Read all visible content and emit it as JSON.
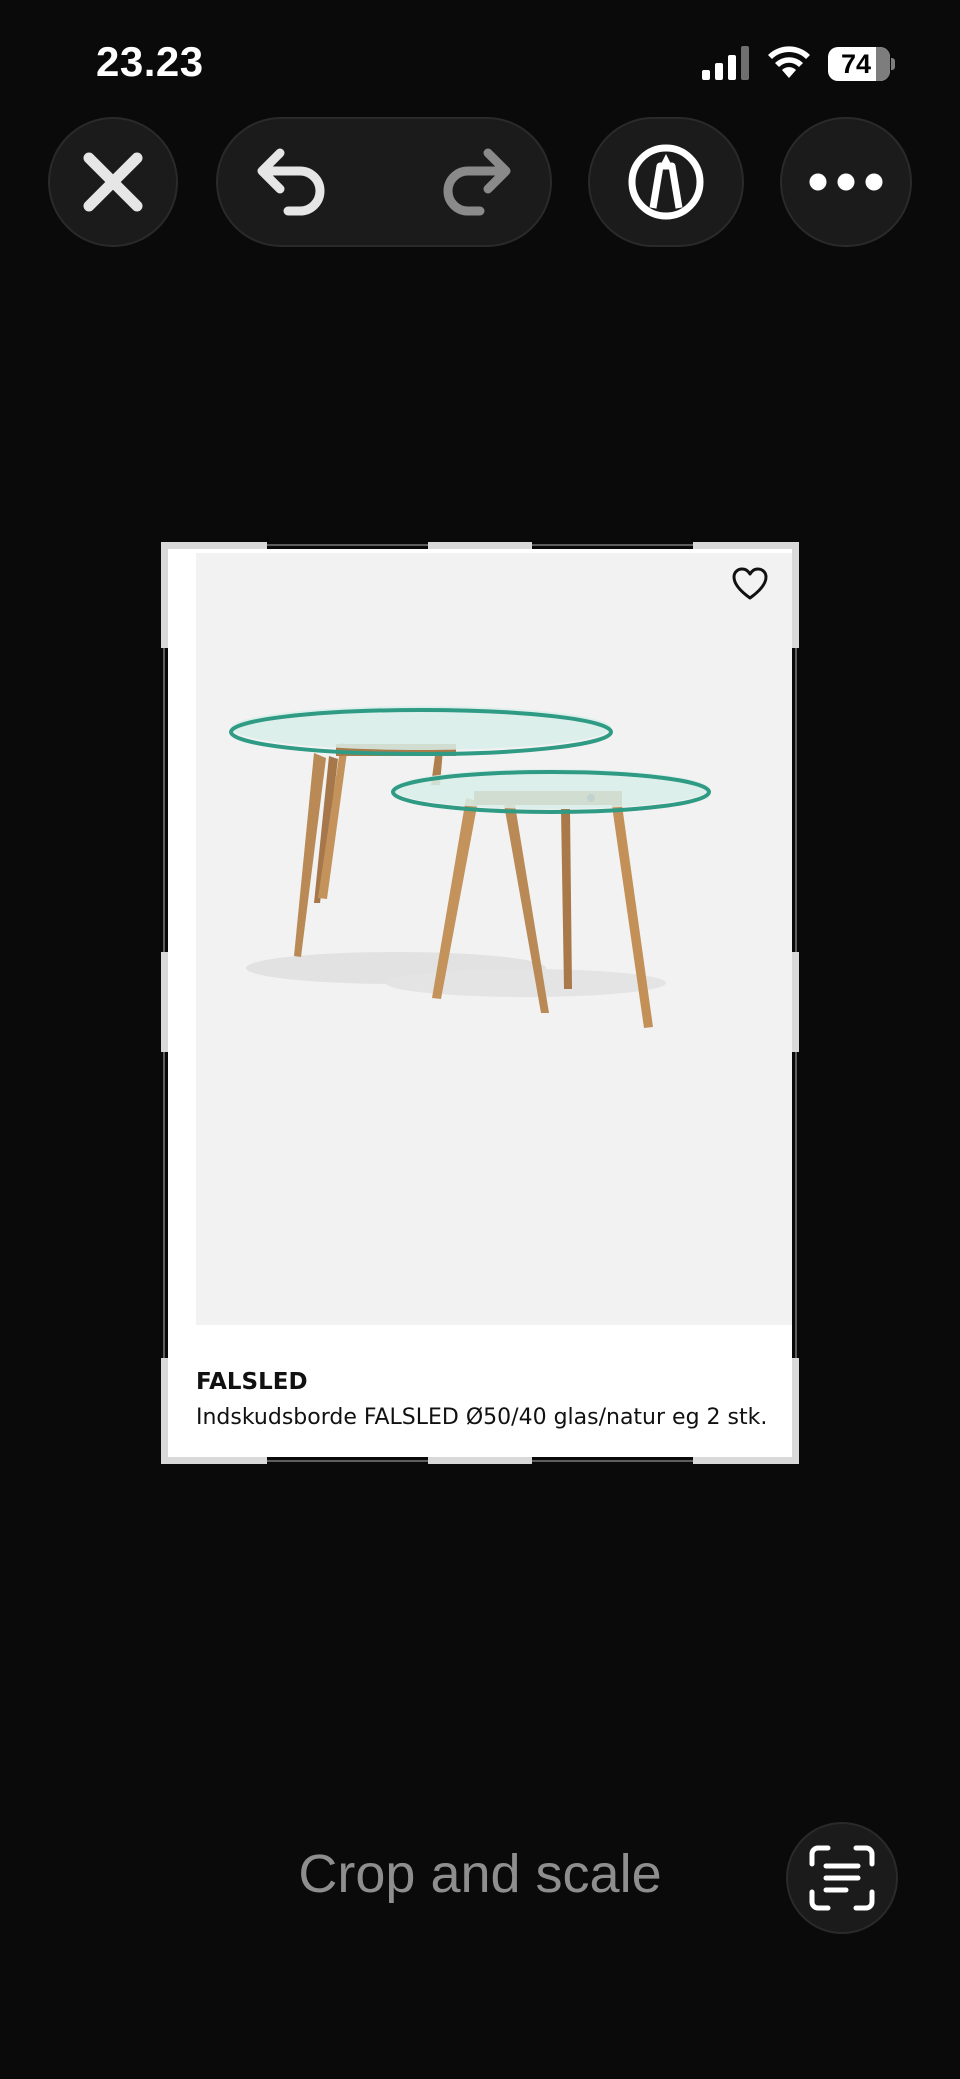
{
  "status_bar": {
    "time": "23.23",
    "battery": "74"
  },
  "toolbar": {
    "close_icon": "close-icon",
    "undo_icon": "undo-icon",
    "redo_icon": "redo-icon",
    "markup_icon": "markup-pen-icon",
    "more_icon": "more-icon"
  },
  "product": {
    "title": "FALSLED",
    "description": "Indskudsborde FALSLED Ø50/40 glas/natur eg 2 stk.",
    "favorite_icon": "heart-icon"
  },
  "footer": {
    "mode_label": "Crop and scale",
    "live_text_icon": "live-text-icon"
  },
  "colors": {
    "background": "#0a0a0a",
    "button_bg": "#1b1b1b",
    "label_gray": "#8e8e8e"
  }
}
